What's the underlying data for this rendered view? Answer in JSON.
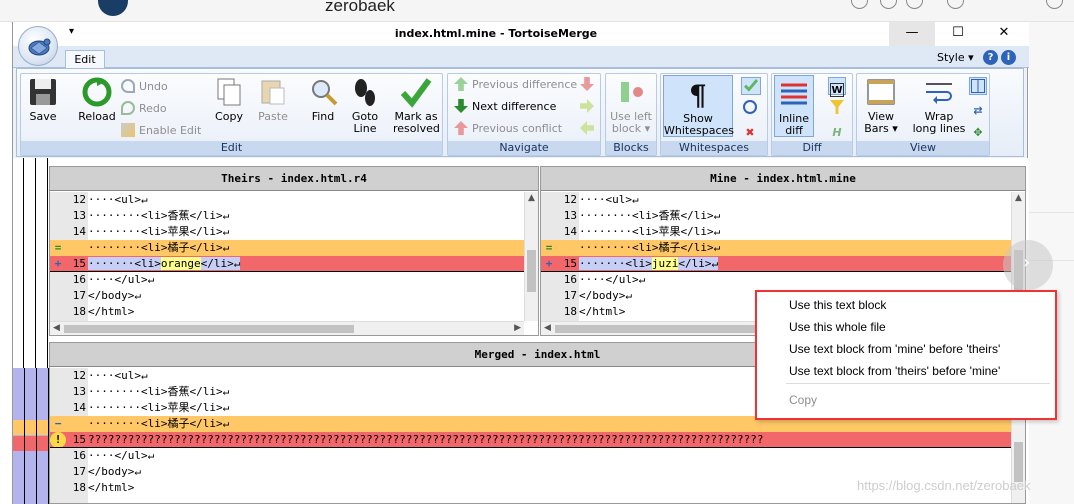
{
  "browser": {
    "username": "zerobaek"
  },
  "window": {
    "title": "index.html.mine - TortoiseMerge",
    "minimize": "—",
    "maximize": "☐",
    "close": "✕",
    "quick_access": "▾"
  },
  "ribbon": {
    "tab": "Edit",
    "style_label": "Style",
    "style_arrow": "▾",
    "help": "?",
    "info": "i",
    "groups": {
      "edit": "Edit",
      "navigate": "Navigate",
      "blocks": "Blocks",
      "whitespaces": "Whitespaces",
      "diff": "Diff",
      "view": "View"
    },
    "buttons": {
      "save": "Save",
      "reload": "Reload",
      "undo": "Undo",
      "redo": "Redo",
      "enable_edit": "Enable Edit",
      "copy": "Copy",
      "paste": "Paste",
      "find": "Find",
      "goto_line_1": "Goto",
      "goto_line_2": "Line",
      "mark_resolved_1": "Mark as",
      "mark_resolved_2": "resolved",
      "prev_diff": "Previous difference",
      "next_diff": "Next difference",
      "prev_conflict": "Previous conflict",
      "use_left_block_1": "Use left",
      "use_left_block_2": "block ▾",
      "show_ws_1": "Show",
      "show_ws_2": "Whitespaces",
      "inline_diff_1": "Inline",
      "inline_diff_2": "diff",
      "view_bars_1": "View",
      "view_bars_2": "Bars ▾",
      "wrap_lines_1": "Wrap",
      "wrap_lines_2": "long lines"
    }
  },
  "panes": {
    "theirs": {
      "header": "Theirs - index.html.r4",
      "lines": [
        {
          "num": "12",
          "text": "····<ul>↵",
          "kind": "normal",
          "gutter": ""
        },
        {
          "num": "13",
          "text": "········<li>香蕉</li>↵",
          "kind": "normal",
          "gutter": ""
        },
        {
          "num": "14",
          "text": "········<li>苹果</li>↵",
          "kind": "normal",
          "gutter": ""
        },
        {
          "num": "",
          "text": "········<li>橘子</li>↵",
          "kind": "changed",
          "gutter": "="
        },
        {
          "num": "15",
          "pre": "·······<li>",
          "word": "orange",
          "post": "</li>↵",
          "kind": "added",
          "gutter": "+"
        },
        {
          "num": "16",
          "text": "····</ul>↵",
          "kind": "normal",
          "gutter": ""
        },
        {
          "num": "17",
          "text": "</body>↵",
          "kind": "normal",
          "gutter": ""
        },
        {
          "num": "18",
          "text": "</html>",
          "kind": "normal",
          "gutter": ""
        }
      ]
    },
    "mine": {
      "header": "Mine - index.html.mine",
      "lines": [
        {
          "num": "12",
          "text": "····<ul>↵",
          "kind": "normal",
          "gutter": ""
        },
        {
          "num": "13",
          "text": "········<li>香蕉</li>↵",
          "kind": "normal",
          "gutter": ""
        },
        {
          "num": "14",
          "text": "········<li>苹果</li>↵",
          "kind": "normal",
          "gutter": ""
        },
        {
          "num": "",
          "text": "········<li>橘子</li>↵",
          "kind": "changed",
          "gutter": "="
        },
        {
          "num": "15",
          "pre": "·······<li>",
          "word": "juzi",
          "post": "</li>↵",
          "kind": "added",
          "gutter": "+"
        },
        {
          "num": "16",
          "text": "····</ul>↵",
          "kind": "normal",
          "gutter": ""
        },
        {
          "num": "17",
          "text": "</body>↵",
          "kind": "normal",
          "gutter": ""
        },
        {
          "num": "18",
          "text": "</html>",
          "kind": "normal",
          "gutter": ""
        }
      ]
    },
    "merged": {
      "header": "Merged - index.html",
      "lines": [
        {
          "num": "12",
          "text": "····<ul>↵",
          "kind": "normal",
          "gutter": ""
        },
        {
          "num": "13",
          "text": "········<li>香蕉</li>↵",
          "kind": "normal",
          "gutter": ""
        },
        {
          "num": "14",
          "text": "········<li>苹果</li>↵",
          "kind": "normal",
          "gutter": ""
        },
        {
          "num": "",
          "text": "········<li>橘子</li>↵",
          "kind": "changed",
          "gutter": "−"
        },
        {
          "num": "15",
          "text": "??????????????????????????????????????????????????????????????????????????????????????????????????????",
          "kind": "conflict",
          "gutter": "!"
        },
        {
          "num": "16",
          "text": "····</ul>↵",
          "kind": "normal",
          "gutter": ""
        },
        {
          "num": "17",
          "text": "</body>↵",
          "kind": "normal",
          "gutter": ""
        },
        {
          "num": "18",
          "text": "</html>",
          "kind": "normal",
          "gutter": ""
        }
      ]
    }
  },
  "context_menu": {
    "items": [
      {
        "label": "Use this text block",
        "enabled": true
      },
      {
        "label": "Use this whole file",
        "enabled": true
      },
      {
        "label": "Use text block from 'mine' before 'theirs'",
        "enabled": true
      },
      {
        "label": "Use text block from 'theirs' before 'mine'",
        "enabled": true
      },
      {
        "label": "Copy",
        "enabled": false
      }
    ]
  },
  "watermark": "https://blog.csdn.net/zerobaek",
  "colors": {
    "changed": "#ffc766",
    "added": "#f2676a",
    "inline_word": "#ffff8c",
    "inline_bg": "#c7cff6",
    "menu_outline": "#e33333"
  }
}
